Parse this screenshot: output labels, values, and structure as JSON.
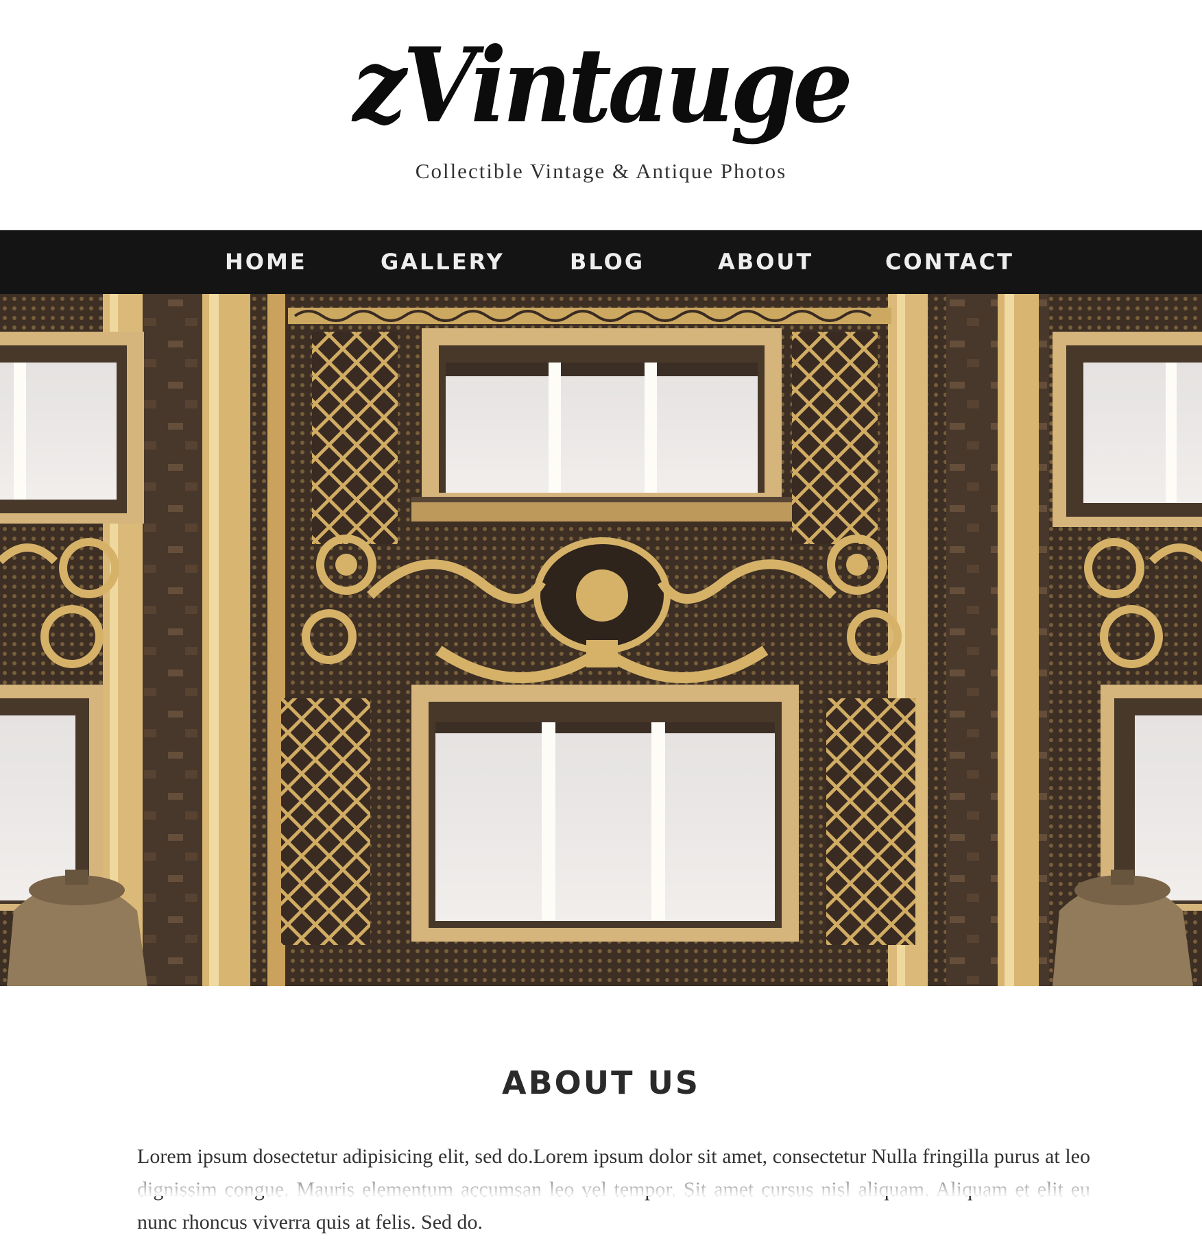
{
  "site": {
    "logo_text": "zVintauge",
    "tagline": "Collectible Vintage & Antique Photos"
  },
  "nav": {
    "items": [
      {
        "label": "HOME"
      },
      {
        "label": "GALLERY"
      },
      {
        "label": "BLOG"
      },
      {
        "label": "ABOUT"
      },
      {
        "label": "CONTACT"
      }
    ]
  },
  "hero": {
    "image": "ornate-vintage-building-facade-photo"
  },
  "about": {
    "title": "ABOUT US",
    "body": "Lorem ipsum dosectetur adipisicing elit, sed do.Lorem ipsum dolor sit amet, consectetur Nulla fringilla purus at leo dignissim congue. Mauris elementum accumsan leo vel tempor. Sit amet cursus nisl aliquam. Aliquam et elit eu nunc rhoncus viverra quis at felis. Sed do."
  },
  "colors": {
    "nav_background": "#141414",
    "nav_text": "#eeeeee",
    "facade_dark": "#2a1d18",
    "facade_gold": "#c9a45c"
  }
}
